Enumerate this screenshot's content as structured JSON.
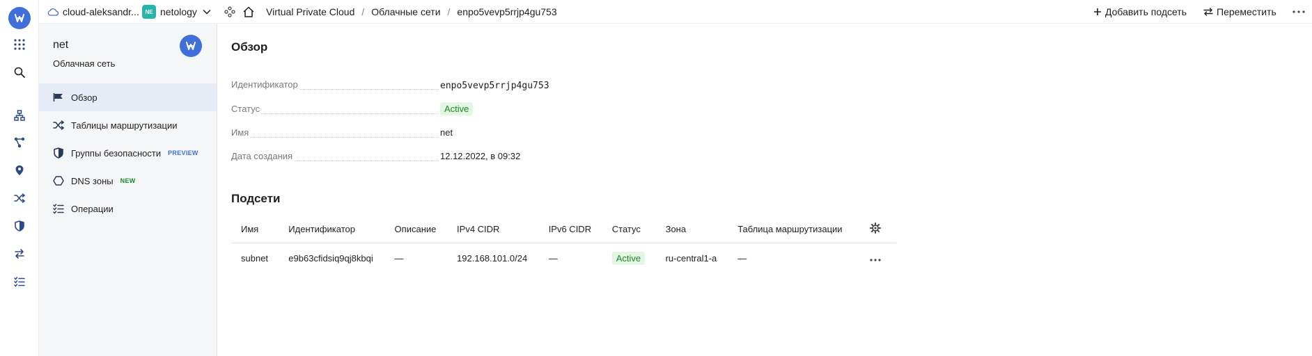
{
  "topbar": {
    "cloud_name": "cloud-aleksandr...",
    "folder_badge": "NE",
    "folder_name": "netology",
    "breadcrumbs": [
      "Virtual Private Cloud",
      "Облачные сети",
      "enpo5vevp5rrjp4gu753"
    ],
    "separator": "/",
    "add_subnet_label": "Добавить подсеть",
    "move_label": "Переместить"
  },
  "sidebar": {
    "title": "net",
    "subtitle": "Облачная сеть",
    "items": [
      {
        "label": "Обзор",
        "icon": "flag-icon",
        "active": true
      },
      {
        "label": "Таблицы маршрутизации",
        "icon": "shuffle-icon"
      },
      {
        "label": "Группы безопасности",
        "icon": "shield-icon",
        "tag": "PREVIEW"
      },
      {
        "label": "DNS зоны",
        "icon": "hexagon-icon",
        "tag": "NEW"
      },
      {
        "label": "Операции",
        "icon": "list-check-icon"
      }
    ]
  },
  "overview": {
    "heading": "Обзор",
    "properties": [
      {
        "label": "Идентификатор",
        "value": "enpo5vevp5rrjp4gu753"
      },
      {
        "label": "Статус",
        "value": "Active"
      },
      {
        "label": "Имя",
        "value": "net"
      },
      {
        "label": "Дата создания",
        "value": "12.12.2022, в 09:32"
      }
    ]
  },
  "subnets": {
    "heading": "Подсети",
    "columns": [
      "Имя",
      "Идентификатор",
      "Описание",
      "IPv4 CIDR",
      "IPv6 CIDR",
      "Статус",
      "Зона",
      "Таблица маршрутизации"
    ],
    "rows": [
      {
        "name": "subnet",
        "id": "e9b63cfidsiq9qj8kbqi",
        "description": "—",
        "ipv4": "192.168.101.0/24",
        "ipv6": "—",
        "status": "Active",
        "zone": "ru-central1-a",
        "route_table": "—"
      }
    ]
  },
  "colors": {
    "accent": "#3f6fd9",
    "active_green": "#1a8a2a",
    "active_bg": "#e4f5e4",
    "nav_active_bg": "#e6ebf5"
  }
}
